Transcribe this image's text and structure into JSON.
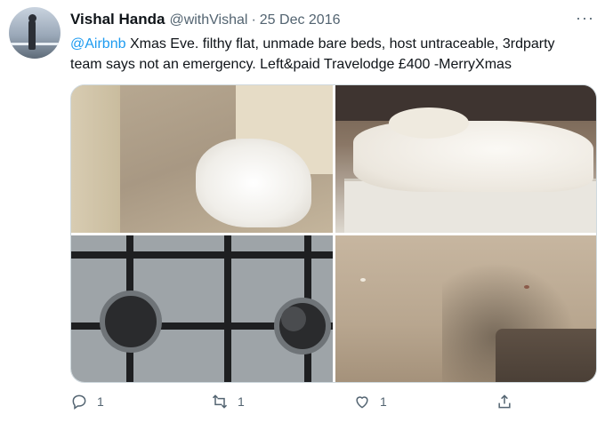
{
  "tweet": {
    "author_name": "Vishal Handa",
    "author_handle": "@withVishal",
    "separator": "·",
    "date": "25 Dec 2016",
    "mention": "@Airbnb",
    "text_line1": " Xmas Eve. filthy flat, unmade bare beds, host untraceable, 3rdparty",
    "text_line2": "team says not an emergency. Left&paid Travelodge £400 -MerryXmas",
    "more_label": "···"
  },
  "media": {
    "count": 4,
    "items": [
      "crumpled-sheets-on-floor",
      "unmade-bed",
      "dirty-gas-hob",
      "stained-carpet"
    ]
  },
  "actions": {
    "reply_count": "1",
    "retweet_count": "1",
    "like_count": "1"
  },
  "icons": {
    "reply": "reply-icon",
    "retweet": "retweet-icon",
    "like": "heart-icon",
    "share": "share-icon",
    "more": "more-icon"
  },
  "colors": {
    "link": "#1d9bf0",
    "secondary_text": "#536471",
    "primary_text": "#0f1419"
  }
}
